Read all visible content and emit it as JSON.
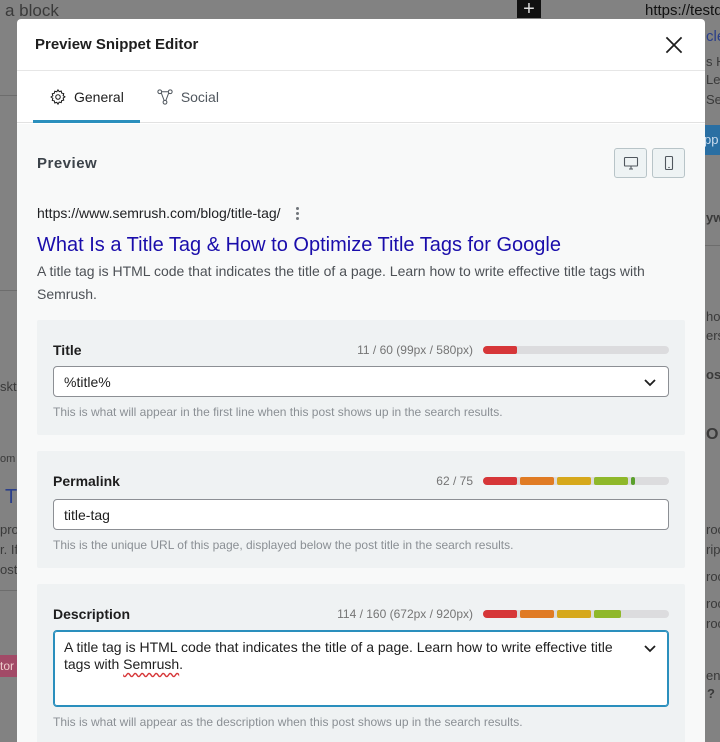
{
  "background": {
    "fragments": [
      "a block",
      "https://testd",
      "cle",
      "s H",
      "Le",
      "Se",
      "pp",
      "yw",
      "hor",
      "ers",
      "os",
      "skt",
      "O",
      "om",
      "T",
      "pro",
      "r. If",
      "ost",
      "roc",
      "ript",
      "roc",
      "roc",
      "roc",
      "ent",
      "?",
      "tor"
    ]
  },
  "modal": {
    "title": "Preview Snippet Editor",
    "close_icon": "close-icon"
  },
  "tabs": [
    {
      "label": "General",
      "icon": "gear-icon",
      "active": true
    },
    {
      "label": "Social",
      "icon": "share-icon",
      "active": false
    }
  ],
  "preview": {
    "label": "Preview",
    "desktop_icon": "desktop-icon",
    "mobile_icon": "mobile-icon",
    "url": "https://www.semrush.com/blog/title-tag/",
    "title": "What Is a Title Tag & How to Optimize Title Tags for Google",
    "description": "A title tag is HTML code that indicates the title of a page. Learn how to write effective title tags with Semrush."
  },
  "title_field": {
    "label": "Title",
    "count": "11 / 60 (99px / 580px)",
    "value": "%title%",
    "help": "This is what will appear in the first line when this post shows up in the search results.",
    "meter_fill": 0.17,
    "meter_color": "#d63638"
  },
  "permalink_field": {
    "label": "Permalink",
    "count": "62 / 75",
    "value": "title-tag",
    "help": "This is the unique URL of this page, displayed below the post title in the search results.",
    "meter_fill": 0.83
  },
  "description_field": {
    "label": "Description",
    "count": "114 / 160 (672px / 920px)",
    "value_main": "A title tag is HTML code that indicates the title of a page. Learn how to write effective title tags with ",
    "value_misspelled": "Semrush",
    "value_end": ".",
    "help": "This is what will appear as the description when this post shows up in the search results.",
    "meter_fill": 0.73
  },
  "colors": {
    "accent": "#2a8fbd",
    "serp_title": "#1a0dab",
    "meter_red": "#d63638",
    "meter_orange": "#e07b24",
    "meter_yellow": "#d6a81b",
    "meter_green": "#7ab528"
  }
}
